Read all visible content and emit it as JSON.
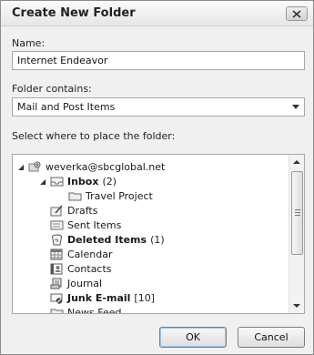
{
  "dialog": {
    "title": "Create New Folder",
    "name_label": "Name:",
    "name_value": "Internet Endeavor",
    "contains_label": "Folder contains:",
    "contains_value": "Mail and Post Items",
    "place_label": "Select where to place the folder:",
    "ok_label": "OK",
    "cancel_label": "Cancel"
  },
  "tree": {
    "account": "weverka@sbcglobal.net",
    "items": [
      {
        "name": "Inbox",
        "count": "(2)",
        "bold": true,
        "icon": "inbox-icon"
      },
      {
        "name": "Travel Project",
        "count": "",
        "bold": false,
        "icon": "folder-icon"
      },
      {
        "name": "Drafts",
        "count": "",
        "bold": false,
        "icon": "drafts-icon"
      },
      {
        "name": "Sent Items",
        "count": "",
        "bold": false,
        "icon": "sent-items-icon"
      },
      {
        "name": "Deleted Items",
        "count": "(1)",
        "bold": true,
        "icon": "deleted-items-icon"
      },
      {
        "name": "Calendar",
        "count": "",
        "bold": false,
        "icon": "calendar-icon"
      },
      {
        "name": "Contacts",
        "count": "",
        "bold": false,
        "icon": "contacts-icon"
      },
      {
        "name": "Journal",
        "count": "",
        "bold": false,
        "icon": "journal-icon"
      },
      {
        "name": "Junk E-mail",
        "count": "[10]",
        "bold": true,
        "icon": "junk-email-icon"
      },
      {
        "name": "News Feed",
        "count": "",
        "bold": false,
        "icon": "news-feed-icon"
      }
    ]
  }
}
